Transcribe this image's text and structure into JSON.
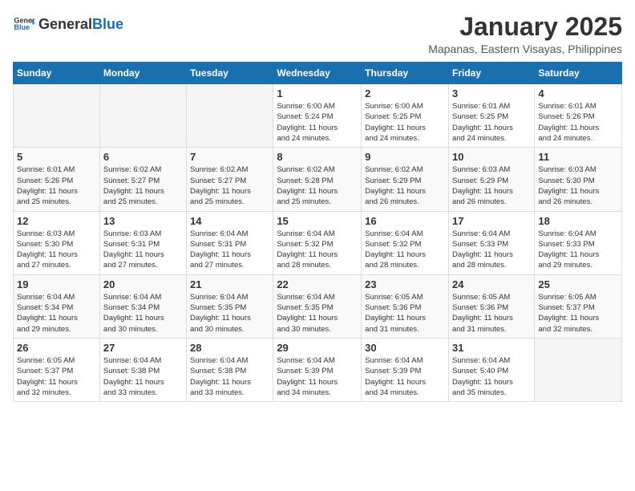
{
  "logo": {
    "general": "General",
    "blue": "Blue"
  },
  "header": {
    "month": "January 2025",
    "location": "Mapanas, Eastern Visayas, Philippines"
  },
  "weekdays": [
    "Sunday",
    "Monday",
    "Tuesday",
    "Wednesday",
    "Thursday",
    "Friday",
    "Saturday"
  ],
  "weeks": [
    [
      {
        "day": "",
        "info": ""
      },
      {
        "day": "",
        "info": ""
      },
      {
        "day": "",
        "info": ""
      },
      {
        "day": "1",
        "info": "Sunrise: 6:00 AM\nSunset: 5:24 PM\nDaylight: 11 hours\nand 24 minutes."
      },
      {
        "day": "2",
        "info": "Sunrise: 6:00 AM\nSunset: 5:25 PM\nDaylight: 11 hours\nand 24 minutes."
      },
      {
        "day": "3",
        "info": "Sunrise: 6:01 AM\nSunset: 5:25 PM\nDaylight: 11 hours\nand 24 minutes."
      },
      {
        "day": "4",
        "info": "Sunrise: 6:01 AM\nSunset: 5:26 PM\nDaylight: 11 hours\nand 24 minutes."
      }
    ],
    [
      {
        "day": "5",
        "info": "Sunrise: 6:01 AM\nSunset: 5:26 PM\nDaylight: 11 hours\nand 25 minutes."
      },
      {
        "day": "6",
        "info": "Sunrise: 6:02 AM\nSunset: 5:27 PM\nDaylight: 11 hours\nand 25 minutes."
      },
      {
        "day": "7",
        "info": "Sunrise: 6:02 AM\nSunset: 5:27 PM\nDaylight: 11 hours\nand 25 minutes."
      },
      {
        "day": "8",
        "info": "Sunrise: 6:02 AM\nSunset: 5:28 PM\nDaylight: 11 hours\nand 25 minutes."
      },
      {
        "day": "9",
        "info": "Sunrise: 6:02 AM\nSunset: 5:29 PM\nDaylight: 11 hours\nand 26 minutes."
      },
      {
        "day": "10",
        "info": "Sunrise: 6:03 AM\nSunset: 5:29 PM\nDaylight: 11 hours\nand 26 minutes."
      },
      {
        "day": "11",
        "info": "Sunrise: 6:03 AM\nSunset: 5:30 PM\nDaylight: 11 hours\nand 26 minutes."
      }
    ],
    [
      {
        "day": "12",
        "info": "Sunrise: 6:03 AM\nSunset: 5:30 PM\nDaylight: 11 hours\nand 27 minutes."
      },
      {
        "day": "13",
        "info": "Sunrise: 6:03 AM\nSunset: 5:31 PM\nDaylight: 11 hours\nand 27 minutes."
      },
      {
        "day": "14",
        "info": "Sunrise: 6:04 AM\nSunset: 5:31 PM\nDaylight: 11 hours\nand 27 minutes."
      },
      {
        "day": "15",
        "info": "Sunrise: 6:04 AM\nSunset: 5:32 PM\nDaylight: 11 hours\nand 28 minutes."
      },
      {
        "day": "16",
        "info": "Sunrise: 6:04 AM\nSunset: 5:32 PM\nDaylight: 11 hours\nand 28 minutes."
      },
      {
        "day": "17",
        "info": "Sunrise: 6:04 AM\nSunset: 5:33 PM\nDaylight: 11 hours\nand 28 minutes."
      },
      {
        "day": "18",
        "info": "Sunrise: 6:04 AM\nSunset: 5:33 PM\nDaylight: 11 hours\nand 29 minutes."
      }
    ],
    [
      {
        "day": "19",
        "info": "Sunrise: 6:04 AM\nSunset: 5:34 PM\nDaylight: 11 hours\nand 29 minutes."
      },
      {
        "day": "20",
        "info": "Sunrise: 6:04 AM\nSunset: 5:34 PM\nDaylight: 11 hours\nand 30 minutes."
      },
      {
        "day": "21",
        "info": "Sunrise: 6:04 AM\nSunset: 5:35 PM\nDaylight: 11 hours\nand 30 minutes."
      },
      {
        "day": "22",
        "info": "Sunrise: 6:04 AM\nSunset: 5:35 PM\nDaylight: 11 hours\nand 30 minutes."
      },
      {
        "day": "23",
        "info": "Sunrise: 6:05 AM\nSunset: 5:36 PM\nDaylight: 11 hours\nand 31 minutes."
      },
      {
        "day": "24",
        "info": "Sunrise: 6:05 AM\nSunset: 5:36 PM\nDaylight: 11 hours\nand 31 minutes."
      },
      {
        "day": "25",
        "info": "Sunrise: 6:05 AM\nSunset: 5:37 PM\nDaylight: 11 hours\nand 32 minutes."
      }
    ],
    [
      {
        "day": "26",
        "info": "Sunrise: 6:05 AM\nSunset: 5:37 PM\nDaylight: 11 hours\nand 32 minutes."
      },
      {
        "day": "27",
        "info": "Sunrise: 6:04 AM\nSunset: 5:38 PM\nDaylight: 11 hours\nand 33 minutes."
      },
      {
        "day": "28",
        "info": "Sunrise: 6:04 AM\nSunset: 5:38 PM\nDaylight: 11 hours\nand 33 minutes."
      },
      {
        "day": "29",
        "info": "Sunrise: 6:04 AM\nSunset: 5:39 PM\nDaylight: 11 hours\nand 34 minutes."
      },
      {
        "day": "30",
        "info": "Sunrise: 6:04 AM\nSunset: 5:39 PM\nDaylight: 11 hours\nand 34 minutes."
      },
      {
        "day": "31",
        "info": "Sunrise: 6:04 AM\nSunset: 5:40 PM\nDaylight: 11 hours\nand 35 minutes."
      },
      {
        "day": "",
        "info": ""
      }
    ]
  ]
}
